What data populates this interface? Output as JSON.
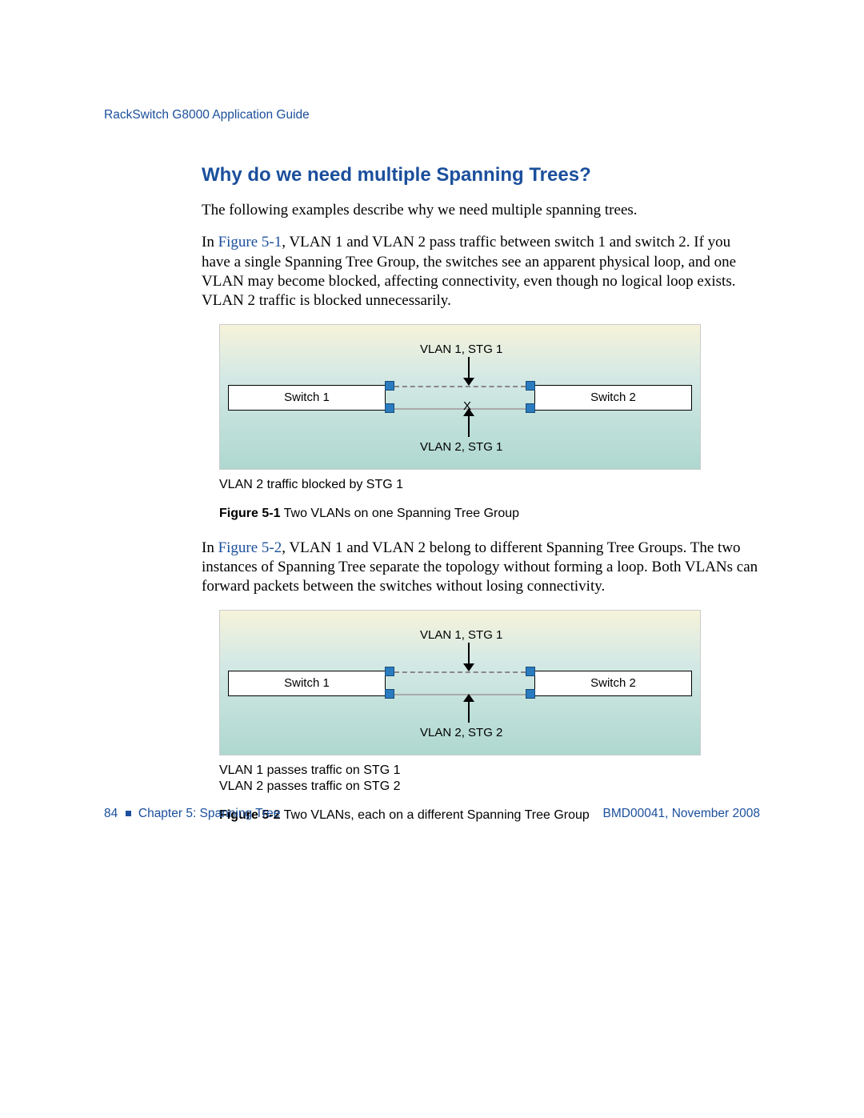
{
  "header": {
    "running_head": "RackSwitch G8000  Application Guide"
  },
  "section": {
    "title": "Why do we need multiple Spanning Trees?",
    "para1": "The following examples describe why we need multiple spanning trees.",
    "para2_a": "In ",
    "para2_ref": "Figure 5-1",
    "para2_b": ", VLAN 1 and VLAN 2 pass traffic between switch 1 and switch 2. If you have a single Spanning Tree Group, the switches see an apparent physical loop, and one VLAN may become blocked, affecting connectivity, even though no logical loop exists. VLAN 2 traffic is blocked unnecessarily.",
    "para3_a": "In ",
    "para3_ref": "Figure 5-2",
    "para3_b": ", VLAN 1 and VLAN 2 belong to different Spanning Tree Groups. The two instances of Spanning Tree separate the topology without forming a loop. Both VLANs can forward packets between the switches without losing connectivity."
  },
  "fig1": {
    "switch1": "Switch 1",
    "switch2": "Switch 2",
    "top_label": "VLAN 1, STG 1",
    "bottom_label": "VLAN 2, STG 1",
    "x": "X",
    "note": "VLAN 2 traffic blocked by STG 1",
    "caption_num": "Figure 5-1",
    "caption_text": "  Two VLANs on one Spanning Tree Group"
  },
  "fig2": {
    "switch1": "Switch 1",
    "switch2": "Switch 2",
    "top_label": "VLAN 1, STG 1",
    "bottom_label": "VLAN 2, STG 2",
    "note1": "VLAN 1 passes traffic on STG 1",
    "note2": "VLAN 2 passes traffic on STG 2",
    "caption_num": "Figure 5-2",
    "caption_text": "  Two VLANs, each on a different Spanning Tree Group"
  },
  "footer": {
    "page_num": "84",
    "chapter": "Chapter 5:  Spanning Tree",
    "doc_id": "BMD00041, November 2008"
  }
}
